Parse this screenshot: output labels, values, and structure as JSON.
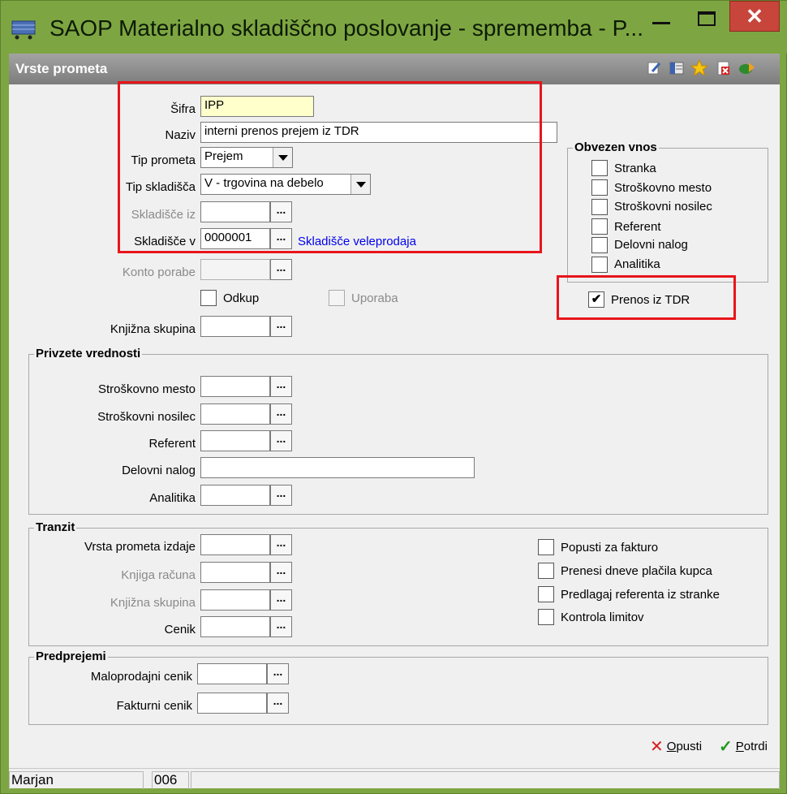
{
  "window": {
    "title": "SAOP Materialno skladiščno poslovanje - sprememba - P...",
    "app_icon": "cart-icon",
    "close_glyph": "✕"
  },
  "header": {
    "title": "Vrste prometa",
    "icons": [
      "edit-icon",
      "columns-icon",
      "star-icon",
      "delete-icon",
      "help-icon"
    ]
  },
  "form": {
    "sifra": {
      "label": "Šifra",
      "value": "IPP"
    },
    "naziv": {
      "label": "Naziv",
      "value": "interni prenos prejem iz TDR"
    },
    "tip_prometa": {
      "label": "Tip prometa",
      "value": "Prejem"
    },
    "tip_skladisca": {
      "label": "Tip skladišča",
      "value": "V - trgovina na debelo"
    },
    "skladisce_iz": {
      "label": "Skladišče iz",
      "value": ""
    },
    "skladisce_v": {
      "label": "Skladišče v",
      "value": "0000001",
      "link": "Skladišče veleprodaja"
    },
    "konto_porabe": {
      "label": "Konto porabe",
      "value": ""
    },
    "odkup": {
      "label": "Odkup",
      "checked": false
    },
    "uporaba": {
      "label": "Uporaba",
      "checked": false
    },
    "knjizna_skupina": {
      "label": "Knjižna skupina",
      "value": ""
    },
    "dots": "..."
  },
  "obvezen_vnos": {
    "title": "Obvezen vnos",
    "items": [
      {
        "label": "Stranka",
        "checked": false
      },
      {
        "label": "Stroškovno mesto",
        "checked": false
      },
      {
        "label": "Stroškovni nosilec",
        "checked": false
      },
      {
        "label": "Referent",
        "checked": false
      },
      {
        "label": "Delovni nalog",
        "checked": false
      },
      {
        "label": "Analitika",
        "checked": false
      }
    ]
  },
  "prenos_tdr": {
    "label": "Prenos iz TDR",
    "checked": true,
    "mark": "✔"
  },
  "privzete": {
    "title": "Privzete vrednosti",
    "stroskovno_mesto": "Stroškovno mesto",
    "stroskovni_nosilec": "Stroškovni nosilec",
    "referent": "Referent",
    "delovni_nalog": "Delovni nalog",
    "analitika": "Analitika"
  },
  "tranzit": {
    "title": "Tranzit",
    "vrsta_prometa_izdaje": "Vrsta prometa izdaje",
    "knjiga_racuna": "Knjiga računa",
    "knjizna_skupina": "Knjižna skupina",
    "cenik": "Cenik",
    "checks": [
      {
        "label": "Popusti za fakturo",
        "checked": false
      },
      {
        "label": "Prenesi dneve plačila kupca",
        "checked": false
      },
      {
        "label": "Predlagaj referenta iz stranke",
        "checked": false
      },
      {
        "label": "Kontrola limitov",
        "checked": false
      }
    ]
  },
  "predprejemi": {
    "title": "Predprejemi",
    "maloprodajni_cenik": "Maloprodajni cenik",
    "fakturni_cenik": "Fakturni cenik"
  },
  "buttons": {
    "opusti": {
      "underlined": "O",
      "rest": "pusti",
      "glyph": "✕",
      "color": "#d42020"
    },
    "potrdi": {
      "underlined": "P",
      "rest": "otrdi",
      "glyph": "✓",
      "color": "#1f9a1f"
    }
  },
  "status": {
    "user": "Marjan",
    "code": "006"
  }
}
